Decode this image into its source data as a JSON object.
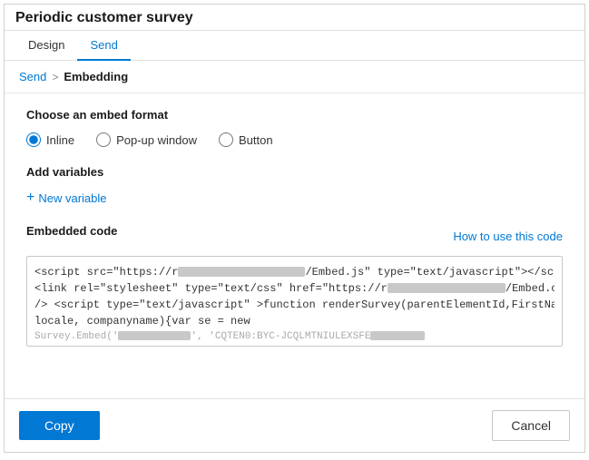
{
  "title": "Periodic customer survey",
  "nav": {
    "tabs": [
      {
        "label": "Design",
        "active": false
      },
      {
        "label": "Send",
        "active": true
      }
    ]
  },
  "breadcrumb": {
    "parent": "Send",
    "separator": ">",
    "current": "Embedding"
  },
  "embed_format": {
    "section_label": "Choose an embed format",
    "options": [
      {
        "label": "Inline",
        "value": "inline",
        "checked": true
      },
      {
        "label": "Pop-up window",
        "value": "popup",
        "checked": false
      },
      {
        "label": "Button",
        "value": "button",
        "checked": false
      }
    ]
  },
  "variables": {
    "section_label": "Add variables",
    "new_variable_label": "New variable"
  },
  "embedded_code": {
    "section_label": "Embedded code",
    "how_to_label": "How to use this code",
    "code_lines": [
      "<script src=\"https://r[redacted]/Embed.js\" type=\"text/javascript\"></script>",
      "<link rel=\"stylesheet\" type=\"text/css\" href=\"https://r[redacted]/Embed.css\" />",
      "<script type=\"text/javascript\" >function renderSurvey(parentElementId,FirstName, LastName, locale, companyname){var se = new",
      "Survey.Embed('[redacted]', 'CQTEN0:BYC-JCQLMTNIULEXSFECD...')"
    ]
  },
  "actions": {
    "copy_label": "Copy",
    "cancel_label": "Cancel"
  }
}
